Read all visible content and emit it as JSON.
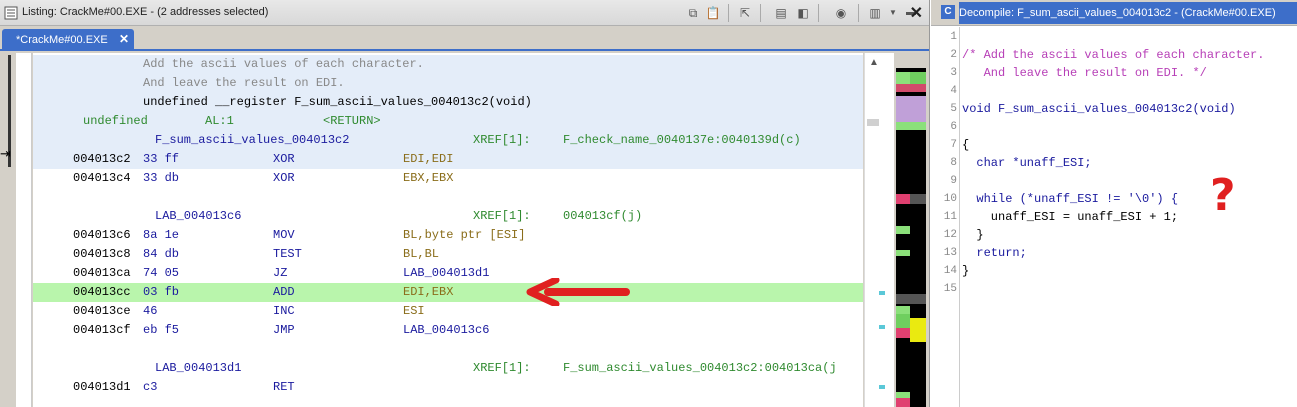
{
  "listing": {
    "title": "Listing:  CrackMe#00.EXE - (2 addresses selected)",
    "tab_label": "*CrackMe#00.EXE",
    "rows": [
      {
        "kind": "comment",
        "text": "Add the ascii values of each character."
      },
      {
        "kind": "comment",
        "text": "And leave the result on EDI."
      },
      {
        "kind": "signature",
        "text": "undefined __register F_sum_ascii_values_004013c2(void)"
      },
      {
        "kind": "return",
        "type": "undefined",
        "reg": "AL:1",
        "ret": "<RETURN>"
      },
      {
        "kind": "label",
        "label": "F_sum_ascii_values_004013c2",
        "xref": "XREF[1]:",
        "xref_target": "F_check_name_0040137e:0040139d(c)"
      },
      {
        "kind": "instr",
        "addr": "004013c2",
        "bytes": "33 ff",
        "mnem": "XOR",
        "oper": "EDI,EDI"
      },
      {
        "kind": "instr",
        "addr": "004013c4",
        "bytes": "33 db",
        "mnem": "XOR",
        "oper": "EBX,EBX"
      },
      {
        "kind": "blank"
      },
      {
        "kind": "label",
        "label": "LAB_004013c6",
        "xref": "XREF[1]:",
        "xref_target": "004013cf(j)"
      },
      {
        "kind": "instr",
        "addr": "004013c6",
        "bytes": "8a 1e",
        "mnem": "MOV",
        "oper": "BL,byte ptr [ESI]"
      },
      {
        "kind": "instr",
        "addr": "004013c8",
        "bytes": "84 db",
        "mnem": "TEST",
        "oper": "BL,BL"
      },
      {
        "kind": "instr",
        "addr": "004013ca",
        "bytes": "74 05",
        "mnem": "JZ",
        "oper": "LAB_004013d1"
      },
      {
        "kind": "instr",
        "addr": "004013cc",
        "bytes": "03 fb",
        "mnem": "ADD",
        "oper": "EDI,EBX"
      },
      {
        "kind": "instr",
        "addr": "004013ce",
        "bytes": "46",
        "mnem": "INC",
        "oper": "ESI"
      },
      {
        "kind": "instr",
        "addr": "004013cf",
        "bytes": "eb f5",
        "mnem": "JMP",
        "oper": "LAB_004013c6"
      },
      {
        "kind": "blank"
      },
      {
        "kind": "label",
        "label": "LAB_004013d1",
        "xref": "XREF[1]:",
        "xref_target": "F_sum_ascii_values_004013c2:004013ca(j"
      },
      {
        "kind": "instr",
        "addr": "004013d1",
        "bytes": "c3",
        "mnem": "RET",
        "oper": ""
      }
    ]
  },
  "decompile": {
    "title": "Decompile: F_sum_ascii_values_004013c2 -  (CrackMe#00.EXE)",
    "lines": [
      {
        "n": "1",
        "t": ""
      },
      {
        "n": "2",
        "t": "/* Add the ascii values of each character."
      },
      {
        "n": "3",
        "t": "   And leave the result on EDI. */"
      },
      {
        "n": "4",
        "t": ""
      },
      {
        "n": "5",
        "t": "void F_sum_ascii_values_004013c2(void)"
      },
      {
        "n": "6",
        "t": ""
      },
      {
        "n": "7",
        "t": "{"
      },
      {
        "n": "8",
        "t": "  char *unaff_ESI;"
      },
      {
        "n": "9",
        "t": ""
      },
      {
        "n": "10",
        "t": "  while (*unaff_ESI != '\\0') {"
      },
      {
        "n": "11",
        "t": "    unaff_ESI = unaff_ESI + 1;"
      },
      {
        "n": "12",
        "t": "  }"
      },
      {
        "n": "13",
        "t": "  return;"
      },
      {
        "n": "14",
        "t": "}"
      },
      {
        "n": "15",
        "t": ""
      }
    ]
  },
  "annotation": {
    "question_mark": "?"
  },
  "colors": {
    "selection": "#e4edf9",
    "highlight": "#b9f5ac",
    "accent": "#3d6ec9",
    "annotation_red": "#e02020"
  }
}
